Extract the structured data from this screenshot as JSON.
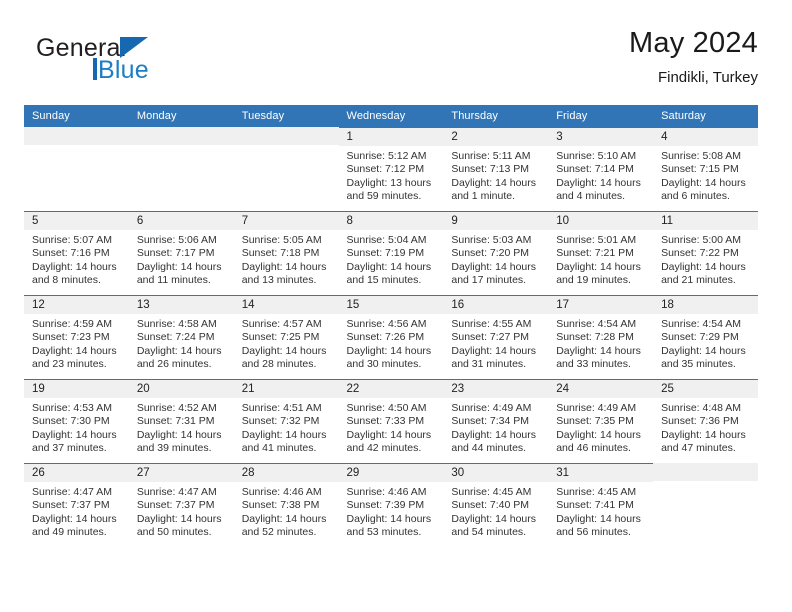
{
  "brand": {
    "name_part1": "General",
    "name_part2": "Blue"
  },
  "header": {
    "title": "May 2024",
    "subtitle": "Findikli, Turkey"
  },
  "colors": {
    "header_blue": "#3175b6",
    "brand_blue": "#1668b0",
    "day_band": "#f0f0f0"
  },
  "weekday_headers": [
    "Sunday",
    "Monday",
    "Tuesday",
    "Wednesday",
    "Thursday",
    "Friday",
    "Saturday"
  ],
  "labels": {
    "sunrise": "Sunrise:",
    "sunset": "Sunset:",
    "daylight": "Daylight:"
  },
  "weeks": [
    [
      {
        "day": "",
        "sunrise": "",
        "sunset": "",
        "daylight_1": "",
        "daylight_2": "",
        "empty": true
      },
      {
        "day": "",
        "sunrise": "",
        "sunset": "",
        "daylight_1": "",
        "daylight_2": "",
        "empty": true
      },
      {
        "day": "",
        "sunrise": "",
        "sunset": "",
        "daylight_1": "",
        "daylight_2": "",
        "empty": true
      },
      {
        "day": "1",
        "sunrise": "Sunrise: 5:12 AM",
        "sunset": "Sunset: 7:12 PM",
        "daylight_1": "Daylight: 13 hours",
        "daylight_2": "and 59 minutes."
      },
      {
        "day": "2",
        "sunrise": "Sunrise: 5:11 AM",
        "sunset": "Sunset: 7:13 PM",
        "daylight_1": "Daylight: 14 hours",
        "daylight_2": "and 1 minute."
      },
      {
        "day": "3",
        "sunrise": "Sunrise: 5:10 AM",
        "sunset": "Sunset: 7:14 PM",
        "daylight_1": "Daylight: 14 hours",
        "daylight_2": "and 4 minutes."
      },
      {
        "day": "4",
        "sunrise": "Sunrise: 5:08 AM",
        "sunset": "Sunset: 7:15 PM",
        "daylight_1": "Daylight: 14 hours",
        "daylight_2": "and 6 minutes."
      }
    ],
    [
      {
        "day": "5",
        "sunrise": "Sunrise: 5:07 AM",
        "sunset": "Sunset: 7:16 PM",
        "daylight_1": "Daylight: 14 hours",
        "daylight_2": "and 8 minutes."
      },
      {
        "day": "6",
        "sunrise": "Sunrise: 5:06 AM",
        "sunset": "Sunset: 7:17 PM",
        "daylight_1": "Daylight: 14 hours",
        "daylight_2": "and 11 minutes."
      },
      {
        "day": "7",
        "sunrise": "Sunrise: 5:05 AM",
        "sunset": "Sunset: 7:18 PM",
        "daylight_1": "Daylight: 14 hours",
        "daylight_2": "and 13 minutes."
      },
      {
        "day": "8",
        "sunrise": "Sunrise: 5:04 AM",
        "sunset": "Sunset: 7:19 PM",
        "daylight_1": "Daylight: 14 hours",
        "daylight_2": "and 15 minutes."
      },
      {
        "day": "9",
        "sunrise": "Sunrise: 5:03 AM",
        "sunset": "Sunset: 7:20 PM",
        "daylight_1": "Daylight: 14 hours",
        "daylight_2": "and 17 minutes."
      },
      {
        "day": "10",
        "sunrise": "Sunrise: 5:01 AM",
        "sunset": "Sunset: 7:21 PM",
        "daylight_1": "Daylight: 14 hours",
        "daylight_2": "and 19 minutes."
      },
      {
        "day": "11",
        "sunrise": "Sunrise: 5:00 AM",
        "sunset": "Sunset: 7:22 PM",
        "daylight_1": "Daylight: 14 hours",
        "daylight_2": "and 21 minutes."
      }
    ],
    [
      {
        "day": "12",
        "sunrise": "Sunrise: 4:59 AM",
        "sunset": "Sunset: 7:23 PM",
        "daylight_1": "Daylight: 14 hours",
        "daylight_2": "and 23 minutes."
      },
      {
        "day": "13",
        "sunrise": "Sunrise: 4:58 AM",
        "sunset": "Sunset: 7:24 PM",
        "daylight_1": "Daylight: 14 hours",
        "daylight_2": "and 26 minutes."
      },
      {
        "day": "14",
        "sunrise": "Sunrise: 4:57 AM",
        "sunset": "Sunset: 7:25 PM",
        "daylight_1": "Daylight: 14 hours",
        "daylight_2": "and 28 minutes."
      },
      {
        "day": "15",
        "sunrise": "Sunrise: 4:56 AM",
        "sunset": "Sunset: 7:26 PM",
        "daylight_1": "Daylight: 14 hours",
        "daylight_2": "and 30 minutes."
      },
      {
        "day": "16",
        "sunrise": "Sunrise: 4:55 AM",
        "sunset": "Sunset: 7:27 PM",
        "daylight_1": "Daylight: 14 hours",
        "daylight_2": "and 31 minutes."
      },
      {
        "day": "17",
        "sunrise": "Sunrise: 4:54 AM",
        "sunset": "Sunset: 7:28 PM",
        "daylight_1": "Daylight: 14 hours",
        "daylight_2": "and 33 minutes."
      },
      {
        "day": "18",
        "sunrise": "Sunrise: 4:54 AM",
        "sunset": "Sunset: 7:29 PM",
        "daylight_1": "Daylight: 14 hours",
        "daylight_2": "and 35 minutes."
      }
    ],
    [
      {
        "day": "19",
        "sunrise": "Sunrise: 4:53 AM",
        "sunset": "Sunset: 7:30 PM",
        "daylight_1": "Daylight: 14 hours",
        "daylight_2": "and 37 minutes."
      },
      {
        "day": "20",
        "sunrise": "Sunrise: 4:52 AM",
        "sunset": "Sunset: 7:31 PM",
        "daylight_1": "Daylight: 14 hours",
        "daylight_2": "and 39 minutes."
      },
      {
        "day": "21",
        "sunrise": "Sunrise: 4:51 AM",
        "sunset": "Sunset: 7:32 PM",
        "daylight_1": "Daylight: 14 hours",
        "daylight_2": "and 41 minutes."
      },
      {
        "day": "22",
        "sunrise": "Sunrise: 4:50 AM",
        "sunset": "Sunset: 7:33 PM",
        "daylight_1": "Daylight: 14 hours",
        "daylight_2": "and 42 minutes."
      },
      {
        "day": "23",
        "sunrise": "Sunrise: 4:49 AM",
        "sunset": "Sunset: 7:34 PM",
        "daylight_1": "Daylight: 14 hours",
        "daylight_2": "and 44 minutes."
      },
      {
        "day": "24",
        "sunrise": "Sunrise: 4:49 AM",
        "sunset": "Sunset: 7:35 PM",
        "daylight_1": "Daylight: 14 hours",
        "daylight_2": "and 46 minutes."
      },
      {
        "day": "25",
        "sunrise": "Sunrise: 4:48 AM",
        "sunset": "Sunset: 7:36 PM",
        "daylight_1": "Daylight: 14 hours",
        "daylight_2": "and 47 minutes."
      }
    ],
    [
      {
        "day": "26",
        "sunrise": "Sunrise: 4:47 AM",
        "sunset": "Sunset: 7:37 PM",
        "daylight_1": "Daylight: 14 hours",
        "daylight_2": "and 49 minutes."
      },
      {
        "day": "27",
        "sunrise": "Sunrise: 4:47 AM",
        "sunset": "Sunset: 7:37 PM",
        "daylight_1": "Daylight: 14 hours",
        "daylight_2": "and 50 minutes."
      },
      {
        "day": "28",
        "sunrise": "Sunrise: 4:46 AM",
        "sunset": "Sunset: 7:38 PM",
        "daylight_1": "Daylight: 14 hours",
        "daylight_2": "and 52 minutes."
      },
      {
        "day": "29",
        "sunrise": "Sunrise: 4:46 AM",
        "sunset": "Sunset: 7:39 PM",
        "daylight_1": "Daylight: 14 hours",
        "daylight_2": "and 53 minutes."
      },
      {
        "day": "30",
        "sunrise": "Sunrise: 4:45 AM",
        "sunset": "Sunset: 7:40 PM",
        "daylight_1": "Daylight: 14 hours",
        "daylight_2": "and 54 minutes."
      },
      {
        "day": "31",
        "sunrise": "Sunrise: 4:45 AM",
        "sunset": "Sunset: 7:41 PM",
        "daylight_1": "Daylight: 14 hours",
        "daylight_2": "and 56 minutes."
      },
      {
        "day": "",
        "sunrise": "",
        "sunset": "",
        "daylight_1": "",
        "daylight_2": "",
        "empty": true
      }
    ]
  ]
}
